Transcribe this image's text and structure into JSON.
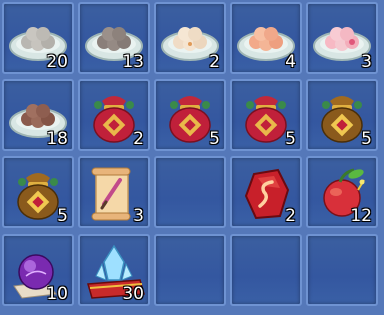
{
  "inventory": {
    "slots": [
      {
        "item": "plate-dumplings-white",
        "count": "20"
      },
      {
        "item": "plate-dumplings-gray",
        "count": "13"
      },
      {
        "item": "plate-dumplings-cream",
        "count": "2"
      },
      {
        "item": "plate-dumplings-peach",
        "count": "4"
      },
      {
        "item": "plate-dumplings-pink",
        "count": "3"
      },
      {
        "item": "plate-dumplings-brown",
        "count": "18"
      },
      {
        "item": "lucky-bag-red",
        "count": "2"
      },
      {
        "item": "lucky-bag-red",
        "count": "5"
      },
      {
        "item": "lucky-bag-red",
        "count": "5"
      },
      {
        "item": "lucky-bag-gold",
        "count": "5"
      },
      {
        "item": "lucky-bag-gold",
        "count": "5"
      },
      {
        "item": "scroll-brush",
        "count": "3"
      },
      {
        "item": "empty",
        "count": ""
      },
      {
        "item": "red-rune-stone",
        "count": "2"
      },
      {
        "item": "glowing-fruit",
        "count": "12"
      },
      {
        "item": "purple-orb",
        "count": "10"
      },
      {
        "item": "crystal-on-carpet",
        "count": "30"
      },
      {
        "item": "empty",
        "count": ""
      },
      {
        "item": "empty",
        "count": ""
      },
      {
        "item": "empty",
        "count": ""
      }
    ]
  },
  "colors": {
    "background": "#5578b9",
    "slot_border": "#6f93d2",
    "slot_fill": "#3457a0"
  }
}
